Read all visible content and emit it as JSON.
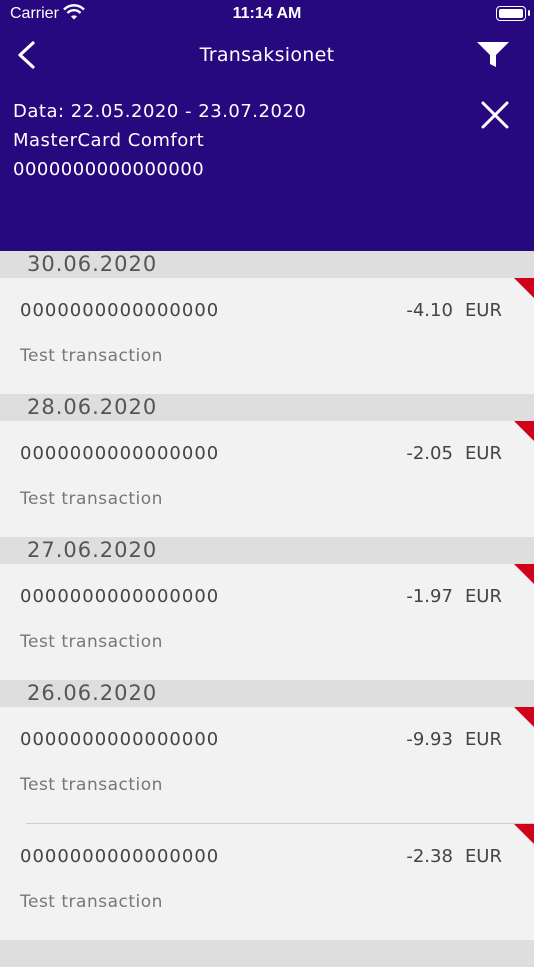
{
  "status_bar": {
    "carrier": "Carrier",
    "time": "11:14 AM"
  },
  "nav": {
    "title": "Transaksionet"
  },
  "info": {
    "date_range": "Data: 22.05.2020 - 23.07.2020",
    "card_name": "MasterCard Comfort",
    "card_number": "0000000000000000"
  },
  "groups": [
    {
      "date": "30.06.2020",
      "transactions": [
        {
          "account": "0000000000000000",
          "amount": "-4.10",
          "currency": "EUR",
          "description": "Test transaction"
        }
      ]
    },
    {
      "date": "28.06.2020",
      "transactions": [
        {
          "account": "0000000000000000",
          "amount": "-2.05",
          "currency": "EUR",
          "description": "Test transaction"
        }
      ]
    },
    {
      "date": "27.06.2020",
      "transactions": [
        {
          "account": "0000000000000000",
          "amount": "-1.97",
          "currency": "EUR",
          "description": "Test transaction"
        }
      ]
    },
    {
      "date": "26.06.2020",
      "transactions": [
        {
          "account": "0000000000000000",
          "amount": "-9.93",
          "currency": "EUR",
          "description": "Test transaction"
        },
        {
          "account": "0000000000000000",
          "amount": "-2.38",
          "currency": "EUR",
          "description": "Test transaction"
        }
      ]
    }
  ],
  "colors": {
    "header_bg": "#27087f",
    "flag": "#d0021b",
    "section_bg": "#dedede",
    "row_bg": "#f2f2f2"
  }
}
